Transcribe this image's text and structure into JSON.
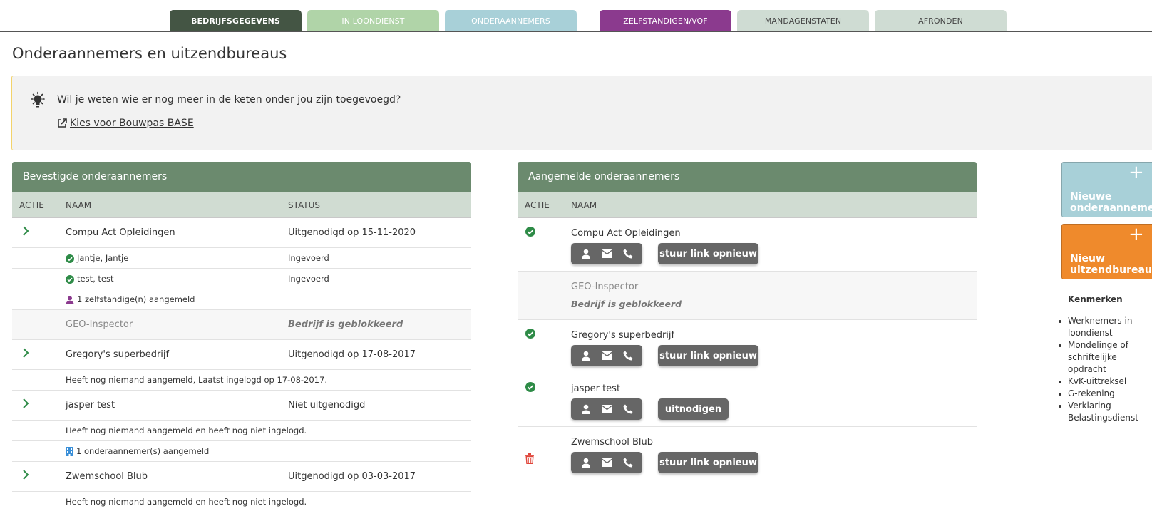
{
  "tabs": [
    "Bedrijfsgegevens",
    "In loondienst",
    "Onderaannemers",
    "Zelfstandigen/VOF",
    "Mandagenstaten",
    "Afronden"
  ],
  "page_title": "Onderaannemers en uitzendbureaus",
  "info": {
    "text": "Wil je weten wie er nog meer in de keten onder jou zijn toegevoegd?",
    "link": "Kies voor Bouwpas BASE"
  },
  "left_panel": {
    "title": "Bevestigde onderaannemers",
    "columns": [
      "ACTIE",
      "NAAM",
      "STATUS"
    ],
    "rows": {
      "r1_name": "Compu Act Opleidingen",
      "r1_status": "Uitgenodigd op 15-11-2020",
      "r1_sub1_name": "Jantje, Jantje",
      "r1_sub1_status": "Ingevoerd",
      "r1_sub2_name": "test, test",
      "r1_sub2_status": "Ingevoerd",
      "r1_sub3": "1 zelfstandige(n) aangemeld",
      "r2_name": "GEO-Inspector",
      "r2_status": "Bedrijf is geblokkeerd",
      "r3_name": "Gregory's superbedrijf",
      "r3_status": "Uitgenodigd op 17-08-2017",
      "r3_sub": "Heeft nog niemand aangemeld, Laatst ingelogd op 17-08-2017.",
      "r4_name": "jasper test",
      "r4_status": "Niet uitgenodigd",
      "r4_sub1": "Heeft nog niemand aangemeld en heeft nog niet ingelogd.",
      "r4_sub2": "1 onderaannemer(s) aangemeld",
      "r5_name": "Zwemschool Blub",
      "r5_status": "Uitgenodigd op 03-03-2017",
      "r5_sub": "Heeft nog niemand aangemeld en heeft nog niet ingelogd."
    }
  },
  "right_panel": {
    "title": "Aangemelde onderaannemers",
    "columns": [
      "ACTIE",
      "NAAM"
    ],
    "rows": {
      "r1_name": "Compu Act Opleidingen",
      "r1_action": "stuur link opnieuw",
      "r2_name": "GEO-Inspector",
      "r2_status": "Bedrijf is geblokkeerd",
      "r3_name": "Gregory's superbedrijf",
      "r3_action": "stuur link opnieuw",
      "r4_name": "jasper test",
      "r4_action": "uitnodigen",
      "r5_name": "Zwemschool Blub",
      "r5_action": "stuur link opnieuw"
    }
  },
  "side_buttons": {
    "new_sub": "Nieuwe onderaannemer",
    "new_agency": "Nieuw uitzendbureau",
    "plus": "+"
  },
  "kenmerken": {
    "title": "Kenmerken",
    "items": [
      "Werknemers in loondienst",
      "Mondelinge of schriftelijke opdracht",
      "KvK-uittreksel",
      "G-rekening",
      "Verklaring Belastingsdienst"
    ]
  },
  "colors": {
    "accent_green": "#2e8b47",
    "panel_header": "#6b8a6e",
    "purple": "#8b3a8e",
    "orange": "#ef8a2c",
    "delete_red": "#e0463b"
  }
}
